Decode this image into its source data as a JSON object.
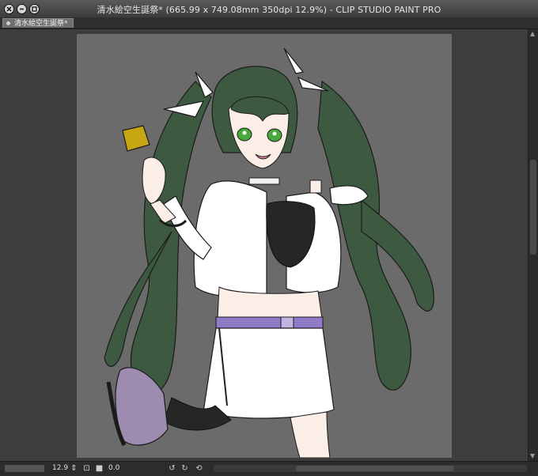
{
  "window": {
    "title": "清水絵空生誕祭* (665.99 x 749.08mm 350dpi 12.9%)  - CLIP STUDIO PAINT PRO",
    "buttons": [
      "close-icon",
      "minimize-icon",
      "maximize-icon"
    ]
  },
  "tabs": [
    {
      "label": "清水絵空生誕祭*"
    }
  ],
  "status": {
    "zoom": "12.9",
    "rotation": "0.0"
  },
  "colors": {
    "canvas_bg": "#6b6b6b",
    "hair": "#3d5a40",
    "skirt_belt": "#8f7bc8",
    "shoe": "#9d8bb0",
    "card": "#c7a614",
    "eyes": "#48a83c"
  }
}
